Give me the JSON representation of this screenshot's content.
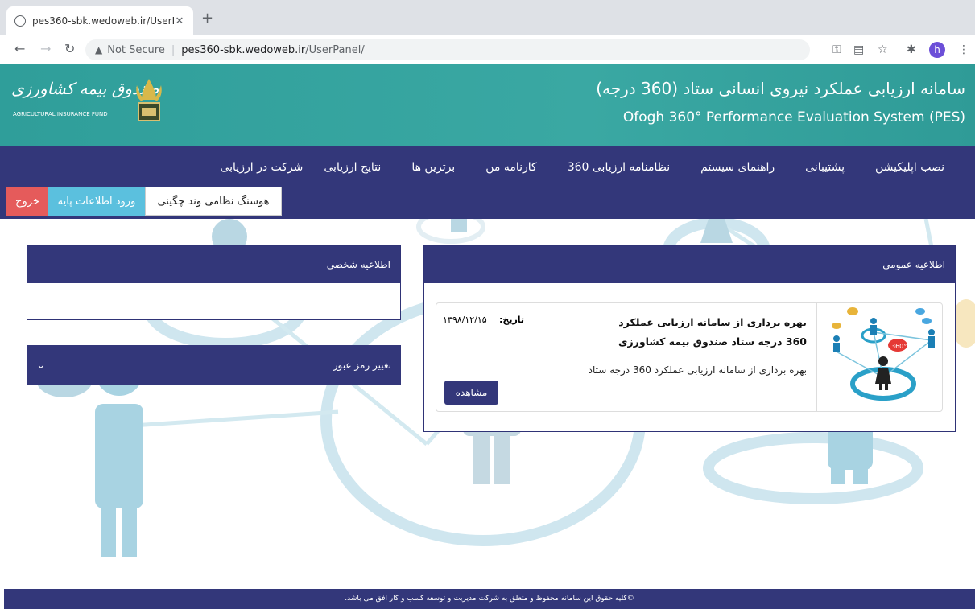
{
  "browser": {
    "tab_title": "pes360-sbk.wedoweb.ir/UserP",
    "new_tab": "+",
    "not_secure": "Not Secure",
    "url_domain": "pes360-sbk.wedoweb.ir",
    "url_path": "/UserPanel/",
    "avatar_letter": "h"
  },
  "header": {
    "title_fa": "سامانه ارزیابی عملکرد نیروی انسانی ستاد (360 درجه)",
    "title_en": "Ofogh 360° Performance Evaluation System (PES)",
    "logo_fa": "صندوق بیمه کشاورزی",
    "logo_en": "AGRICULTURAL INSURANCE FUND"
  },
  "nav": {
    "items": [
      "شرکت در ارزیابی",
      "نتایج ارزیابی",
      "برترین ها",
      "کارنامه من",
      "نظامنامه ارزیابی 360",
      "راهنمای سیستم",
      "پشتیبانی",
      "نصب اپلیکیشن"
    ],
    "user_name": "هوشنگ نظامی وند چگینی",
    "base_info": "ورود اطلاعات پایه",
    "exit": "خروج"
  },
  "public_notice": {
    "heading": "اطلاعیه عمومی",
    "news": {
      "title": "بهره برداری از سامانه ارزیابی عملکرد 360 درجه ستاد صندوق بیمه کشاورزی",
      "date_label": "تاریخ:",
      "date": "۱۳۹۸/۱۲/۱۵",
      "description": "بهره برداری از سامانه ارزیابی عملکرد 360 درجه ستاد",
      "view_button": "مشاهده"
    }
  },
  "personal_notice": {
    "heading": "اطلاعیه شخصی"
  },
  "password_panel": {
    "heading": "تغییر رمز عبور"
  },
  "footer": {
    "text": "©کلیه حقوق این سامانه محفوظ و متعلق به شرکت مدیریت و توسعه کسب و کار افق می باشد."
  },
  "colors": {
    "header_bg": "#35a39f",
    "nav_bg": "#33377a",
    "exit_btn": "#e55b5b",
    "base_btn": "#5bc0de"
  }
}
